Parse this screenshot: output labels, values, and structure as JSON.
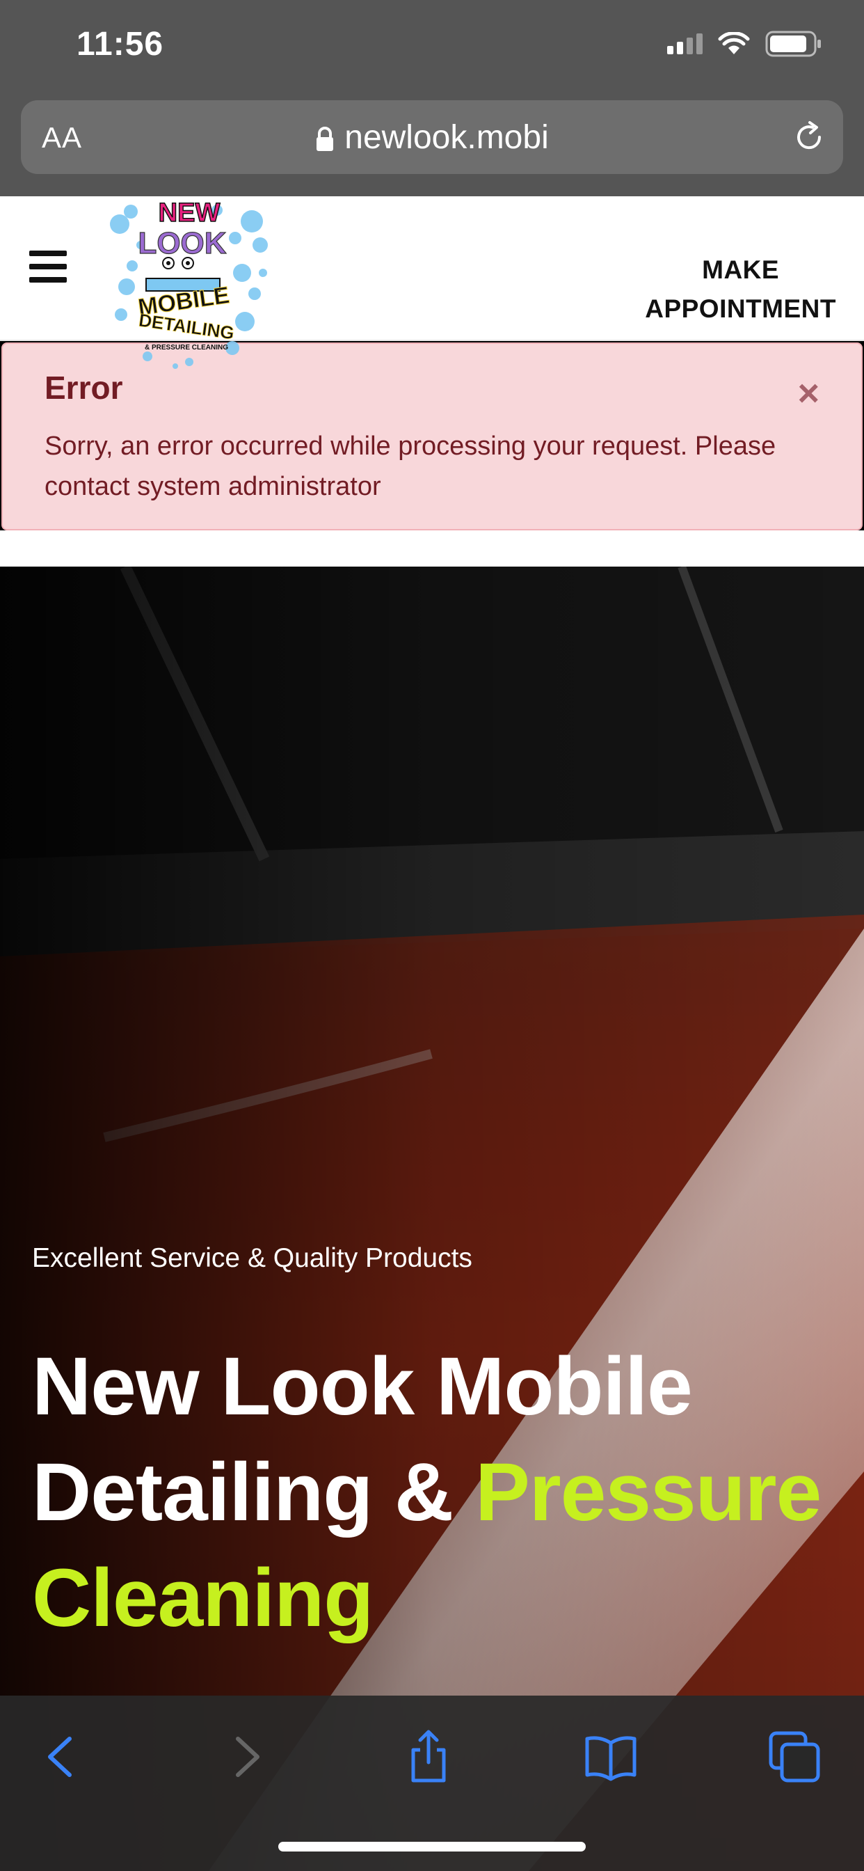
{
  "status_bar": {
    "time": "11:56",
    "icons": [
      "signal-icon",
      "wifi-icon",
      "battery-icon"
    ]
  },
  "browser": {
    "text_size_label": "AA",
    "url": "newlook.mobi",
    "icons": [
      "lock-icon",
      "reload-icon"
    ]
  },
  "header": {
    "logo_text": [
      "NEW",
      "LOOK",
      "MOBILE",
      "DETAILING",
      "& PRESSURE CLEANING"
    ],
    "appointment_label_line1": "MAKE",
    "appointment_label_line2": "APPOINTMENT"
  },
  "alert": {
    "title": "Error",
    "message": "Sorry, an error occurred while processing your request. Please contact system administrator",
    "close_symbol": "×"
  },
  "hero": {
    "subtitle": "Excellent Service & Quality Products",
    "title_part1": "New Look Mobile Detailing & ",
    "title_accent": "Pressure Cleaning"
  },
  "toolbar": {
    "buttons": [
      "back-icon",
      "forward-icon",
      "share-icon",
      "bookmarks-icon",
      "tabs-icon"
    ]
  },
  "colors": {
    "alert_bg": "#f8d7da",
    "alert_text": "#721c24",
    "hero_accent": "#c6f01f",
    "toolbar_blue": "#3a82f7"
  }
}
